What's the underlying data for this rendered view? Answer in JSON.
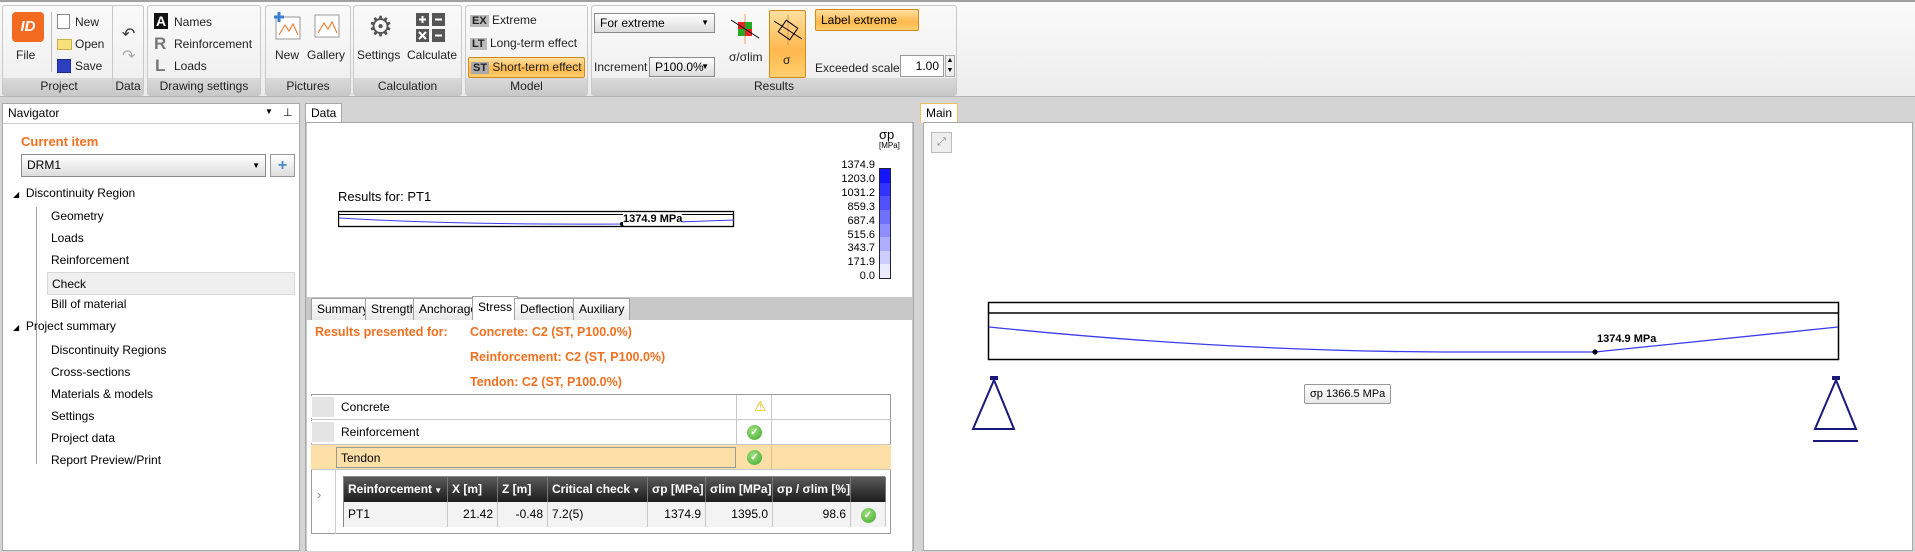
{
  "ribbon": {
    "groups": {
      "project": "Project",
      "data": "Data",
      "drawing": "Drawing settings",
      "pictures": "Pictures",
      "calculation": "Calculation",
      "model": "Model",
      "results": "Results"
    },
    "file": "File",
    "new": "New",
    "open": "Open",
    "save": "Save",
    "names": "Names",
    "reinforcement": "Reinforcement",
    "loads": "Loads",
    "names_glyph": "A",
    "reinf_glyph": "R",
    "loads_glyph": "L",
    "pic_new": "New",
    "gallery": "Gallery",
    "settings": "Settings",
    "calculate": "Calculate",
    "model": [
      {
        "badge": "EX",
        "label": "Extreme"
      },
      {
        "badge": "LT",
        "label": "Long-term effect"
      },
      {
        "badge": "ST",
        "label": "Short-term effect"
      }
    ],
    "extreme_combo": "For extreme",
    "increment_label": "Increment",
    "increment_value": "P100.0%",
    "sigma_ratio": "σ/σlim",
    "sigma": "σ",
    "label_extreme": "Label extreme",
    "exceeded_label": "Exceeded scale",
    "exceeded_value": "1.00"
  },
  "navigator": {
    "title": "Navigator",
    "current_item": "Current item",
    "combo": "DRM1",
    "groups": [
      {
        "label": "Discontinuity Region",
        "items": [
          "Geometry",
          "Loads",
          "Reinforcement",
          "Check",
          "Bill of material"
        ]
      },
      {
        "label": "Project summary",
        "items": [
          "Discontinuity Regions",
          "Cross-sections",
          "Materials & models",
          "Settings",
          "Project data",
          "Report Preview/Print"
        ]
      }
    ],
    "selected": "Check"
  },
  "data_panel": {
    "tab": "Data",
    "results_for": "Results for: PT1",
    "max_label": "1374.9 MPa",
    "legend": {
      "title": "σp",
      "unit": "[MPa]",
      "values": [
        "1374.9",
        "1203.0",
        "1031.2",
        "859.3",
        "687.4",
        "515.6",
        "343.7",
        "171.9",
        "0.0"
      ]
    },
    "tabs": [
      "Summary",
      "Strength",
      "Anchorage",
      "Stress",
      "Deflection",
      "Auxiliary"
    ],
    "active_tab": "Stress",
    "presented_label": "Results presented for:",
    "presented": [
      "Concrete: C2 (ST, P100.0%)",
      "Reinforcement: C2 (ST, P100.0%)",
      "Tendon: C2 (ST, P100.0%)"
    ],
    "checks": [
      {
        "name": "Concrete",
        "status": "warning"
      },
      {
        "name": "Reinforcement",
        "status": "ok"
      },
      {
        "name": "Tendon",
        "status": "ok"
      }
    ],
    "table": {
      "columns": [
        "Reinforcement",
        "X [m]",
        "Z [m]",
        "Critical check",
        "σp [MPa]",
        "σlim [MPa]",
        "σp / σlim [%]",
        ""
      ],
      "rows": [
        [
          "PT1",
          "21.42",
          "-0.48",
          "7.2(5)",
          "1374.9",
          "1395.0",
          "98.6"
        ]
      ]
    }
  },
  "main_panel": {
    "tab": "Main",
    "max_label": "1374.9 MPa",
    "tooltip": "σp 1366.5 MPa"
  },
  "colors": {
    "accent": "#f07020",
    "stress_line": "#3b3bf0",
    "support": "#1a1a7a"
  }
}
